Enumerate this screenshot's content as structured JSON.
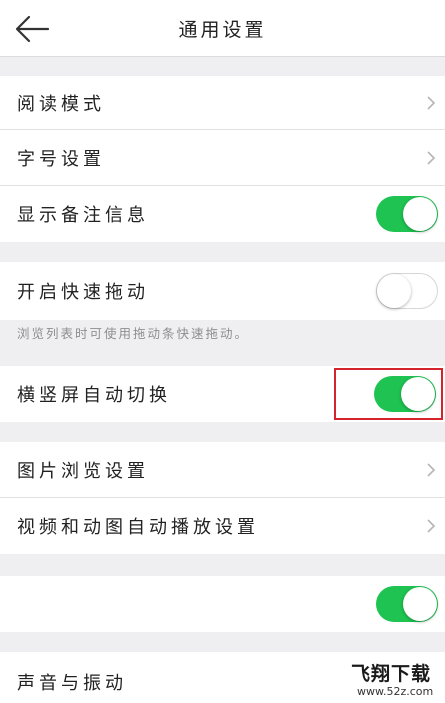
{
  "header": {
    "title": "通用设置",
    "back_icon": "arrow-left-icon"
  },
  "colors": {
    "toggle_on": "#1ec351",
    "highlight": "#d5232c",
    "background": "#efeff1"
  },
  "settings": {
    "reading_mode": "阅读模式",
    "font_size": "字号设置",
    "show_notes": "显示备注信息",
    "fast_drag": "开启快速拖动",
    "fast_drag_hint": "浏览列表时可使用拖动条快速拖动。",
    "auto_rotate": "横竖屏自动切换",
    "image_browse": "图片浏览设置",
    "video_autoplay": "视频和动图自动播放设置",
    "sound_vibration": "声音与振动"
  },
  "toggles": {
    "show_notes": "on",
    "fast_drag": "off",
    "auto_rotate": "on",
    "unlabeled": "on"
  },
  "watermark": {
    "title": "飞翔下载",
    "url": "www.52z.com"
  }
}
